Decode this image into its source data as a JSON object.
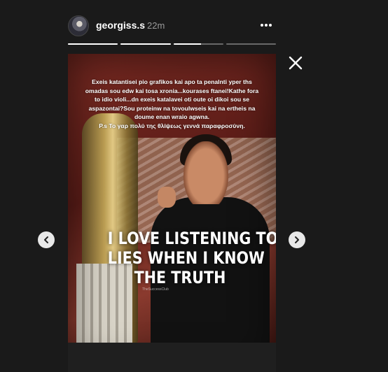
{
  "story": {
    "username": "georgiss.s",
    "time_ago": "22m",
    "progress": [
      1,
      1,
      0.55,
      0
    ],
    "caption_lines": [
      "Exeis katantisei pio grafikos kai apo ta penalnti yper ths",
      "omadas sou edw kai tosa xronia...kourases ftanei!Kathe fora",
      "to idio violi...dn exeis katalavei oti oute oi dikoi sou se",
      "aspazontai?Sou proteinw na tovoulwseis kai na ertheis na",
      "doume enan wraio agwna.",
      "P.s Το γαρ πολύ της θλίψεως γεννά παραφροσύνη."
    ],
    "quote_lines": [
      "I LOVE LISTENING TO",
      "LIES WHEN I KNOW",
      "THE TRUTH"
    ],
    "watermark": "TheSuccessClub"
  },
  "icons": {
    "more": "more-options-icon",
    "close": "close-icon",
    "prev": "chevron-left-icon",
    "next": "chevron-right-icon"
  }
}
